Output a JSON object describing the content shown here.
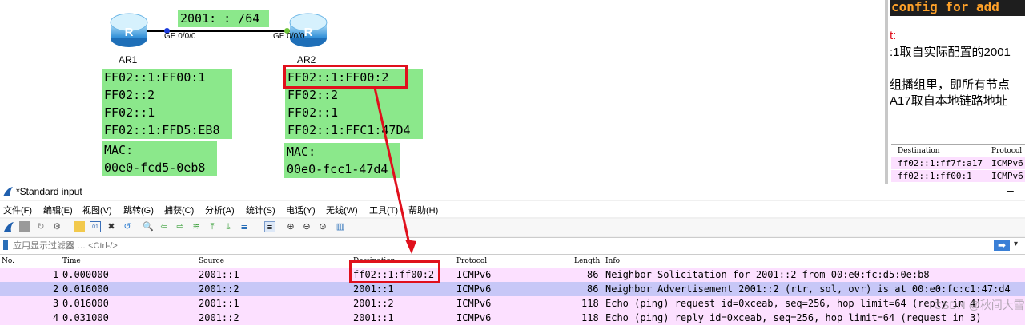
{
  "diagram": {
    "prefix_label": "2001: : /64",
    "routers": [
      {
        "name": "AR1",
        "port": "GE 0/0/0"
      },
      {
        "name": "AR2",
        "port": "GE 0/0/0"
      }
    ],
    "ar1_groups": [
      "FF02::1:FF00:1",
      "FF02::2",
      "FF02::1",
      "FF02::1:FFD5:EB8"
    ],
    "ar1_mac": [
      "MAC:",
      "00e0-fcd5-0eb8"
    ],
    "ar2_groups": [
      "FF02::1:FF00:2",
      "FF02::2",
      "FF02::1",
      "FF02::1:FFC1:47D4"
    ],
    "ar2_mac": [
      "MAC:",
      "00e0-fcc1-47d4"
    ],
    "router_glyph": "R"
  },
  "right_panel": {
    "code_fragment": "config for add",
    "colon_fragment": "t:",
    "lines": [
      ":1取自实际配置的2001",
      "组播组里，即所有节点",
      "A17取自本地链路地址"
    ],
    "mini_table": {
      "headers": [
        "Destination",
        "Protocol"
      ],
      "rows": [
        [
          "ff02::1:ff7f:a17",
          "ICMPv6"
        ],
        [
          "ff02::1:ff00:1",
          "ICMPv6"
        ]
      ]
    }
  },
  "wireshark": {
    "title": "*Standard input",
    "menu": [
      "文件(F)",
      "编辑(E)",
      "视图(V)",
      "跳转(G)",
      "捕获(C)",
      "分析(A)",
      "统计(S)",
      "电话(Y)",
      "无线(W)",
      "工具(T)",
      "帮助(H)"
    ],
    "filter_placeholder": "应用显示过滤器 … <Ctrl-/>",
    "columns": [
      "No.",
      "Time",
      "Source",
      "Destination",
      "Protocol",
      "Length",
      "Info"
    ],
    "packets": [
      {
        "no": "1",
        "time": "0.000000",
        "src": "2001::1",
        "dst": "ff02::1:ff00:2",
        "proto": "ICMPv6",
        "len": "86",
        "info": "Neighbor Solicitation for 2001::2 from 00:e0:fc:d5:0e:b8"
      },
      {
        "no": "2",
        "time": "0.016000",
        "src": "2001::2",
        "dst": "2001::1",
        "proto": "ICMPv6",
        "len": "86",
        "info": "Neighbor Advertisement 2001::2 (rtr, sol, ovr) is at 00:e0:fc:c1:47:d4"
      },
      {
        "no": "3",
        "time": "0.016000",
        "src": "2001::1",
        "dst": "2001::2",
        "proto": "ICMPv6",
        "len": "118",
        "info": "Echo (ping) request id=0xceab, seq=256, hop limit=64 (reply in 4)"
      },
      {
        "no": "4",
        "time": "0.031000",
        "src": "2001::2",
        "dst": "2001::1",
        "proto": "ICMPv6",
        "len": "118",
        "info": "Echo (ping) reply id=0xceab, seq=256, hop limit=64 (request in 3)"
      }
    ],
    "watermark": "CSDN @秋间大雪",
    "colors": {
      "row_icmp": "#fce0ff",
      "row_selected": "#c7c7f7",
      "highlight": "#e0101c",
      "green_box": "#8be88b"
    }
  }
}
